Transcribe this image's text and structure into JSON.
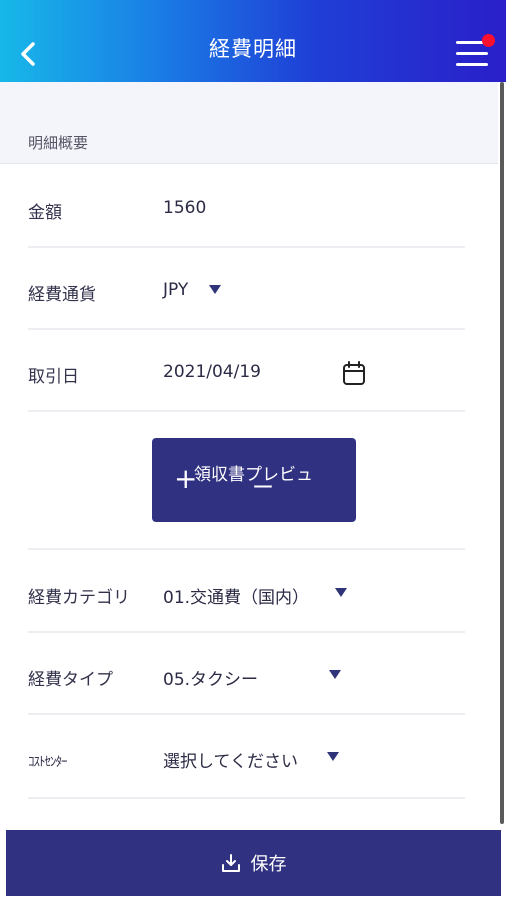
{
  "header": {
    "title": "経費明細",
    "back_icon": "chevron-left-icon",
    "menu_icon": "hamburger-menu-icon",
    "notification_color": "#ff0f2e"
  },
  "section": {
    "title": "明細概要"
  },
  "fields": {
    "amount": {
      "label": "金額",
      "value": "1560"
    },
    "currency": {
      "label": "経費通貨",
      "value": "JPY"
    },
    "date": {
      "label": "取引日",
      "value": "2021/04/19",
      "icon": "calendar-icon"
    },
    "category": {
      "label": "経費カテゴリ",
      "value": "01.交通費（国内）"
    },
    "type": {
      "label": "経費タイプ",
      "value": "05.タクシー"
    },
    "cost_center": {
      "label": "ｺｽﾄｾﾝﾀｰ",
      "value": "選択してください"
    }
  },
  "receipt_button": {
    "plus": "+",
    "label": "領収書プレビュ",
    "minus": "ー"
  },
  "footer": {
    "save_label": "保存",
    "icon": "download-icon"
  },
  "colors": {
    "primary": "#303281",
    "header_start": "#17b8e8",
    "header_end": "#2a1fc9"
  }
}
